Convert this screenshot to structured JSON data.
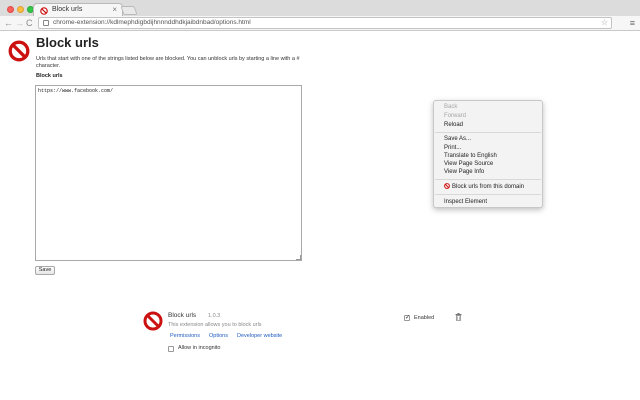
{
  "browser": {
    "tab_title": "Block urls",
    "tab_close": "×",
    "url": "chrome-extension://kdlmephdigbdijhnnnddhdkjaibdnbad/options.html",
    "nav_back": "←",
    "nav_forward": "→",
    "nav_reload": "C",
    "star_icon": "☆",
    "menu_icon": "≡"
  },
  "page": {
    "title": "Block urls",
    "description": "Urls that start with one of the strings listed below are blocked. You can unblock urls by starting a line with a # character.",
    "list_label": "Block urls",
    "list_value": "https://www.facebook.com/",
    "save_label": "Save"
  },
  "extension": {
    "name": "Block urls",
    "version": "1.0.3",
    "description": "This extension allows you to block urls",
    "links": {
      "permissions": "Permissions",
      "options": "Options",
      "developer": "Developer website"
    },
    "incognito_label": "Allow in incognito",
    "enabled_label": "Enabled",
    "enabled_check": "✓"
  },
  "context_menu": {
    "items": [
      {
        "label": "Back",
        "enabled": false
      },
      {
        "label": "Forward",
        "enabled": false
      },
      {
        "label": "Reload",
        "enabled": true
      },
      {
        "label": "Save As...",
        "enabled": true
      },
      {
        "label": "Print...",
        "enabled": true
      },
      {
        "label": "Translate to English",
        "enabled": true
      },
      {
        "label": "View Page Source",
        "enabled": true
      },
      {
        "label": "View Page Info",
        "enabled": true
      },
      {
        "label": "Block urls from this domain",
        "enabled": true
      },
      {
        "label": "Inspect Element",
        "enabled": true
      }
    ]
  },
  "colors": {
    "block_icon_red": "#cc1111",
    "link_blue": "#1f5bbf"
  },
  "icons": [
    "block-icon",
    "trash-icon",
    "star-icon",
    "menu-icon",
    "back-icon",
    "forward-icon",
    "reload-icon"
  ]
}
